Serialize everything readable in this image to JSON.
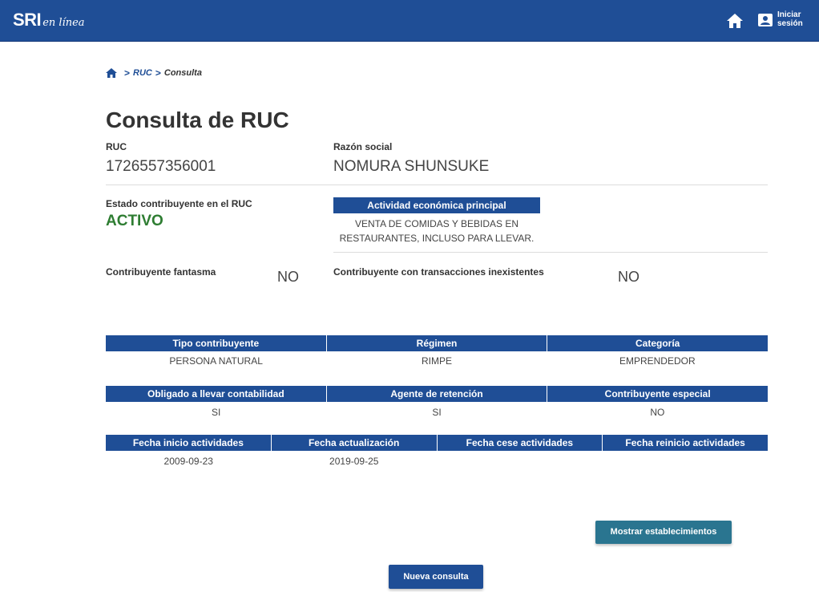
{
  "header": {
    "logo_main": "SRI",
    "logo_sub": "en línea",
    "login_label_1": "Iniciar",
    "login_label_2": "sesión"
  },
  "breadcrumb": {
    "link": "RUC",
    "current": "Consulta"
  },
  "page_title": "Consulta de RUC",
  "ruc": {
    "label": "RUC",
    "value": "1726557356001"
  },
  "razon_social": {
    "label": "Razón social",
    "value": "NOMURA SHUNSUKE"
  },
  "estado": {
    "label": "Estado contribuyente en el RUC",
    "value": "ACTIVO",
    "color": "#2e7d32"
  },
  "actividad": {
    "header": "Actividad económica principal",
    "line1": "VENTA DE COMIDAS Y BEBIDAS EN",
    "line2": "RESTAURANTES, INCLUSO PARA LLEVAR."
  },
  "fantasma": {
    "label": "Contribuyente fantasma",
    "value": "NO"
  },
  "inexistentes": {
    "label": "Contribuyente con transacciones inexistentes",
    "value": "NO"
  },
  "table1": {
    "headers": [
      "Tipo contribuyente",
      "Régimen",
      "Categoría"
    ],
    "values": [
      "PERSONA NATURAL",
      "RIMPE",
      "EMPRENDEDOR"
    ]
  },
  "table2": {
    "headers": [
      "Obligado a llevar contabilidad",
      "Agente de retención",
      "Contribuyente especial"
    ],
    "values": [
      "SI",
      "SI",
      "NO"
    ]
  },
  "table3": {
    "headers": [
      "Fecha inicio actividades",
      "Fecha actualización",
      "Fecha cese actividades",
      "Fecha reinicio actividades"
    ],
    "values": [
      "2009-09-23",
      "2019-09-25",
      "",
      ""
    ]
  },
  "buttons": {
    "mostrar": "Mostrar establecimientos",
    "nueva": "Nueva consulta"
  },
  "colors": {
    "primary": "#1f4e96",
    "accent_teal": "#2a7590",
    "active_green": "#2e7d32"
  }
}
